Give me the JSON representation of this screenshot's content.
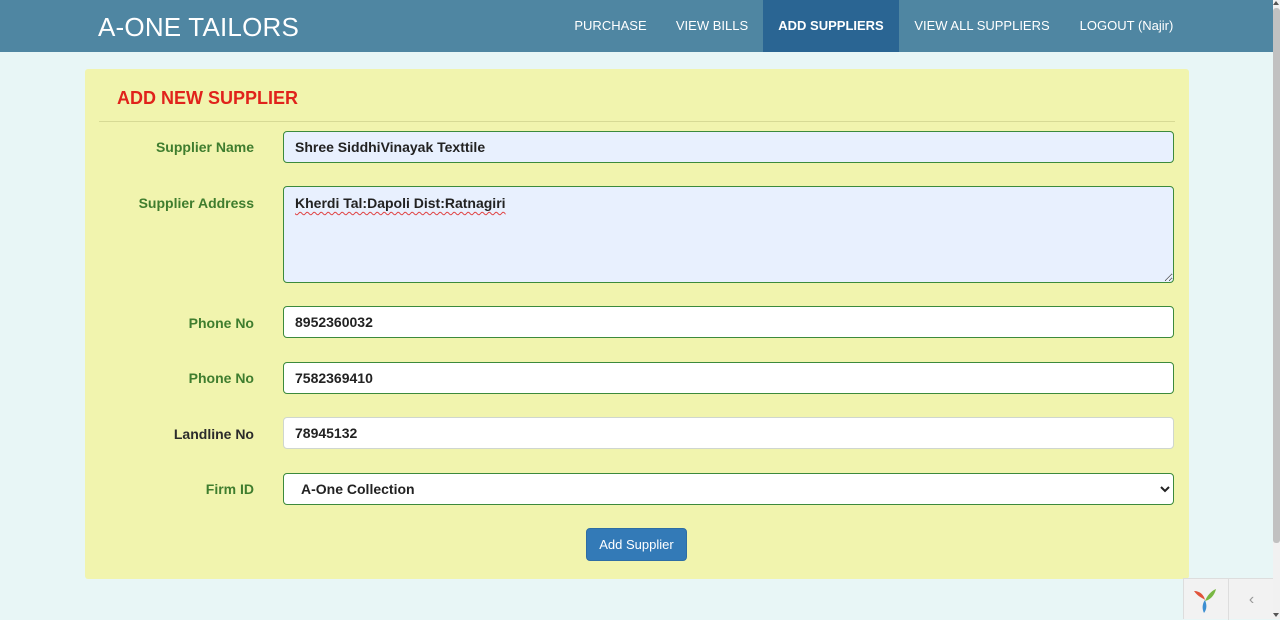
{
  "app": {
    "brand": "A-ONE TAILORS"
  },
  "nav": {
    "items": [
      {
        "label": "PURCHASE"
      },
      {
        "label": "VIEW BILLS"
      },
      {
        "label": "ADD SUPPLIERS",
        "active": true
      },
      {
        "label": "VIEW ALL SUPPLIERS"
      },
      {
        "label": "LOGOUT (Najir)"
      }
    ]
  },
  "form": {
    "title": "ADD NEW SUPPLIER",
    "supplier_name": {
      "label": "Supplier Name",
      "value": "Shree SiddhiVinayak Texttile"
    },
    "supplier_address": {
      "label": "Supplier Address",
      "value": "Kherdi Tal:Dapoli Dist:Ratnagiri"
    },
    "phone1": {
      "label": "Phone No",
      "value": "8952360032"
    },
    "phone2": {
      "label": "Phone No",
      "value": "7582369410"
    },
    "landline": {
      "label": "Landline No",
      "value": "78945132"
    },
    "firm": {
      "label": "Firm ID",
      "selected": "A-One Collection"
    },
    "submit_label": "Add Supplier"
  },
  "debug_toolbar": {
    "collapse_glyph": "‹"
  },
  "colors": {
    "navbar": "#4f86a2",
    "nav_active": "#2a6593",
    "panel": "#f1f4ae",
    "title": "#e0231b",
    "label": "#3f7d2e",
    "button": "#337ab7"
  },
  "icons": {
    "logo": "yii-logo-icon",
    "collapse": "chevron-left-icon",
    "select": "chevron-down-icon"
  }
}
